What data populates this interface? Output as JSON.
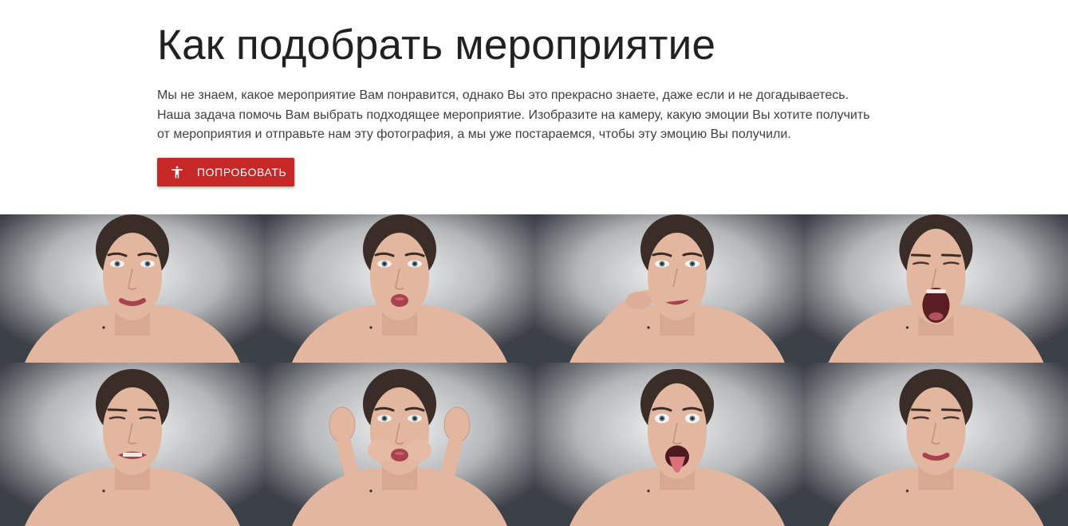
{
  "hero": {
    "title": "Как подобрать мероприятие",
    "description_lines": [
      "Мы не знаем, какое мероприятие Вам понравится, однако Вы это прекрасно знаете, даже если и не догадываетесь.",
      "Наша задача помочь Вам выбрать подходящее мероприятие. Изобразите на камеру, какую эмоции Вы хотите получить",
      "от мероприятия и отправьте нам эту фотография, а мы уже постараемся, чтобы эту эмоцию Вы получили."
    ],
    "button": {
      "label": "ПОПРОБОВАТЬ",
      "icon": "accessibility-icon"
    }
  },
  "colors": {
    "accent": "#c62828",
    "title": "#212121",
    "text": "#404040",
    "photo_background_center": "#f2f2f2",
    "photo_background_edge": "#3c4047",
    "skin": "#e3b6a0",
    "hair": "#3a2c27",
    "lips": "#a8424d"
  },
  "gallery": {
    "photos": [
      {
        "name": "emotion-photo-lip-bite",
        "expression": "lip-bite",
        "hands": "none"
      },
      {
        "name": "emotion-photo-pout",
        "expression": "pout",
        "hands": "none"
      },
      {
        "name": "emotion-photo-finger-mustache",
        "expression": "smirk",
        "hands": "finger-under-nose"
      },
      {
        "name": "emotion-photo-scream",
        "expression": "scream",
        "hands": "none"
      },
      {
        "name": "emotion-photo-disgust",
        "expression": "grimace",
        "hands": "none"
      },
      {
        "name": "emotion-photo-ear-pull",
        "expression": "puffed-cheeks",
        "hands": "pulling-ears"
      },
      {
        "name": "emotion-photo-tongue-out",
        "expression": "tongue-out",
        "hands": "none"
      },
      {
        "name": "emotion-photo-squint",
        "expression": "squint",
        "hands": "none"
      }
    ]
  }
}
